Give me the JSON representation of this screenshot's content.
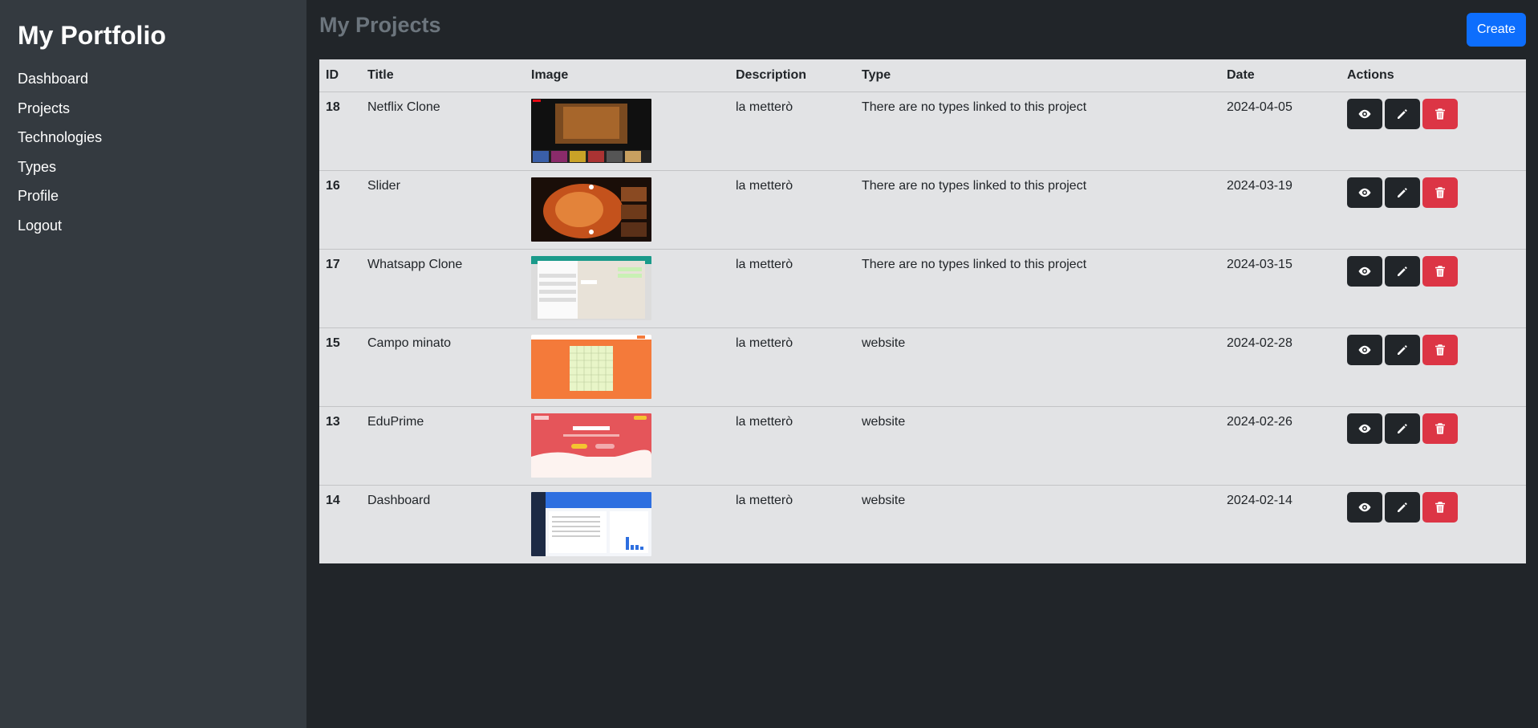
{
  "sidebar": {
    "brand": "My Portfolio",
    "items": [
      {
        "label": "Dashboard"
      },
      {
        "label": "Projects"
      },
      {
        "label": "Technologies"
      },
      {
        "label": "Types"
      },
      {
        "label": "Profile"
      },
      {
        "label": "Logout"
      }
    ]
  },
  "header": {
    "title": "My Projects",
    "create_label": "Create"
  },
  "table": {
    "columns": [
      "ID",
      "Title",
      "Image",
      "Description",
      "Type",
      "Date",
      "Actions"
    ],
    "rows": [
      {
        "id": "18",
        "title": "Netflix Clone",
        "description": "la metterò",
        "type": "There are no types linked to this project",
        "date": "2024-04-05"
      },
      {
        "id": "16",
        "title": "Slider",
        "description": "la metterò",
        "type": "There are no types linked to this project",
        "date": "2024-03-19"
      },
      {
        "id": "17",
        "title": "Whatsapp Clone",
        "description": "la metterò",
        "type": "There are no types linked to this project",
        "date": "2024-03-15"
      },
      {
        "id": "15",
        "title": "Campo minato",
        "description": "la metterò",
        "type": "website",
        "date": "2024-02-28"
      },
      {
        "id": "13",
        "title": "EduPrime",
        "description": "la metterò",
        "type": "website",
        "date": "2024-02-26"
      },
      {
        "id": "14",
        "title": "Dashboard",
        "description": "la metterò",
        "type": "website",
        "date": "2024-02-14"
      }
    ]
  },
  "colors": {
    "primary": "#0d6efd",
    "danger": "#dc3545",
    "dark": "#212529",
    "sidebar_bg": "#343a40",
    "table_bg": "#e2e3e5"
  },
  "icons": {
    "view": "eye-icon",
    "edit": "pencil-icon",
    "delete": "trash-icon"
  }
}
